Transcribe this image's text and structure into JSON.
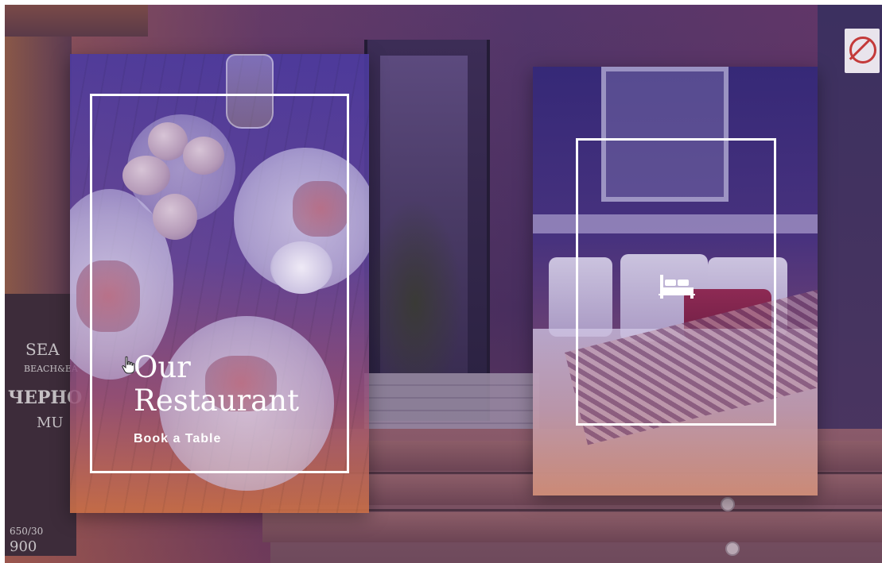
{
  "cards": {
    "restaurant": {
      "title_line1": "Our",
      "title_line2": "Restaurant",
      "link_label": "Book a Table"
    },
    "hotel": {
      "icon": "bed-icon"
    }
  },
  "background": {
    "board_text": [
      "SEA",
      "BEACH&EA",
      "ЧЕРНО",
      "MU",
      "650/30",
      "900"
    ]
  },
  "colors": {
    "overlay_top": "#4b3aa0",
    "overlay_bottom": "#d76e28",
    "frame": "#ffffff",
    "text": "#ffffff"
  }
}
